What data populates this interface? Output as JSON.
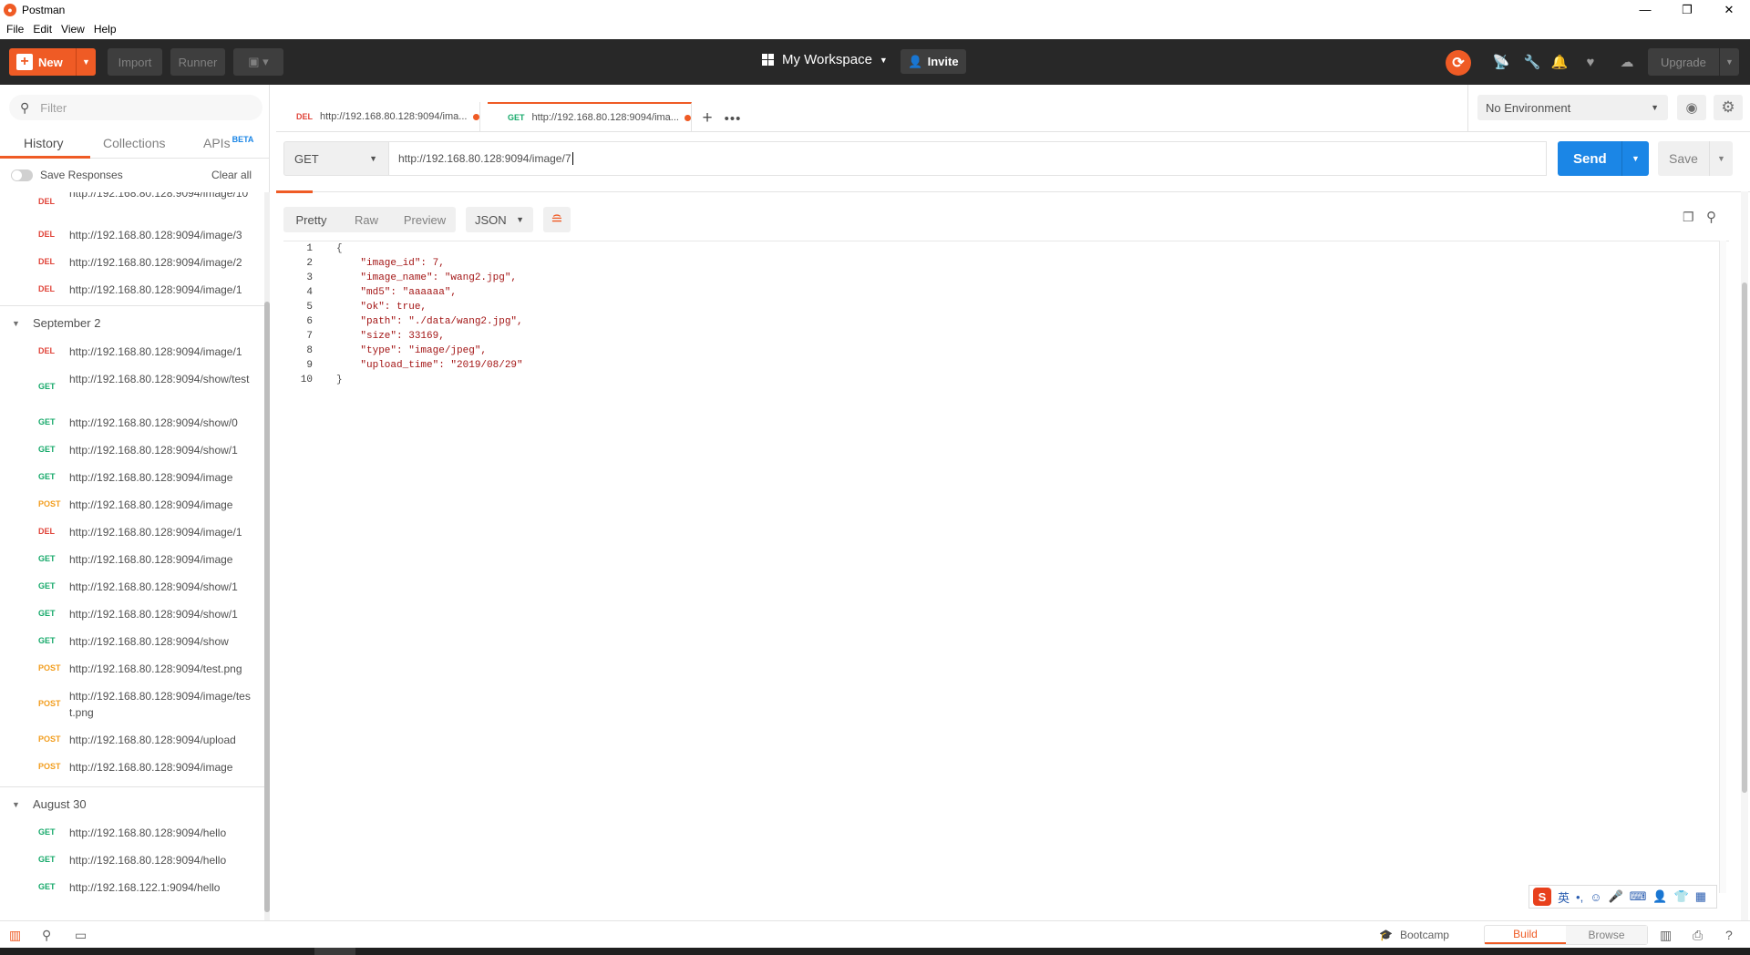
{
  "window": {
    "title": "Postman",
    "minimize_glyph": "—",
    "maximize_glyph": "❐",
    "close_glyph": "✕"
  },
  "menu": [
    "File",
    "Edit",
    "View",
    "Help"
  ],
  "header": {
    "new_label": "New",
    "import_label": "Import",
    "runner_label": "Runner",
    "workspace_label": "My Workspace",
    "invite_label": "Invite",
    "upgrade_label": "Upgrade"
  },
  "sidebar": {
    "filter_placeholder": "Filter",
    "tabs": [
      "History",
      "Collections",
      "APIs"
    ],
    "beta_badge": "BETA",
    "save_responses_label": "Save Responses",
    "clear_all_label": "Clear all",
    "groups": [
      {
        "label": "",
        "items": [
          {
            "method": "DEL",
            "url": "http://192.168.80.128:9094/image/10"
          },
          {
            "method": "DEL",
            "url": "http://192.168.80.128:9094/image/3"
          },
          {
            "method": "DEL",
            "url": "http://192.168.80.128:9094/image/2"
          },
          {
            "method": "DEL",
            "url": "http://192.168.80.128:9094/image/1"
          }
        ]
      },
      {
        "label": "September 2",
        "items": [
          {
            "method": "DEL",
            "url": "http://192.168.80.128:9094/image/1"
          },
          {
            "method": "GET",
            "url": "http://192.168.80.128:9094/show/test"
          },
          {
            "method": "GET",
            "url": "http://192.168.80.128:9094/show/0"
          },
          {
            "method": "GET",
            "url": "http://192.168.80.128:9094/show/1"
          },
          {
            "method": "GET",
            "url": "http://192.168.80.128:9094/image"
          },
          {
            "method": "POST",
            "url": "http://192.168.80.128:9094/image"
          },
          {
            "method": "DEL",
            "url": "http://192.168.80.128:9094/image/1"
          },
          {
            "method": "GET",
            "url": "http://192.168.80.128:9094/image"
          },
          {
            "method": "GET",
            "url": "http://192.168.80.128:9094/show/1"
          },
          {
            "method": "GET",
            "url": "http://192.168.80.128:9094/show/1"
          },
          {
            "method": "GET",
            "url": "http://192.168.80.128:9094/show"
          },
          {
            "method": "POST",
            "url": "http://192.168.80.128:9094/test.png"
          },
          {
            "method": "POST",
            "url": "http://192.168.80.128:9094/image/test.png"
          },
          {
            "method": "POST",
            "url": "http://192.168.80.128:9094/upload"
          },
          {
            "method": "POST",
            "url": "http://192.168.80.128:9094/image"
          }
        ]
      },
      {
        "label": "August 30",
        "items": [
          {
            "method": "GET",
            "url": "http://192.168.80.128:9094/hello"
          },
          {
            "method": "GET",
            "url": "http://192.168.80.128:9094/hello"
          },
          {
            "method": "GET",
            "url": "http://192.168.122.1:9094/hello"
          }
        ]
      }
    ]
  },
  "request_tabs": [
    {
      "method": "DEL",
      "url": "http://192.168.80.128:9094/ima..."
    },
    {
      "method": "GET",
      "url": "http://192.168.80.128:9094/ima..."
    }
  ],
  "environment": {
    "selected": "No Environment"
  },
  "request": {
    "method": "GET",
    "url": "http://192.168.80.128:9094/image/7",
    "send_label": "Send",
    "save_label": "Save"
  },
  "response": {
    "views": [
      "Pretty",
      "Raw",
      "Preview"
    ],
    "format": "JSON",
    "lines": [
      "{",
      "    \"image_id\": 7,",
      "    \"image_name\": \"wang2.jpg\",",
      "    \"md5\": \"aaaaaa\",",
      "    \"ok\": true,",
      "    \"path\": \"./data/wang2.jpg\",",
      "    \"size\": 33169,",
      "    \"type\": \"image/jpeg\",",
      "    \"upload_time\": \"2019/08/29\"",
      "}"
    ]
  },
  "ime": {
    "logo": "S",
    "lang": "英"
  },
  "statusbar": {
    "bootcamp_label": "Bootcamp",
    "build_label": "Build",
    "browse_label": "Browse"
  },
  "colors": {
    "accent": "#ef5b25",
    "primary": "#1b86e6",
    "del": "#e0443a",
    "get": "#16a96a",
    "post": "#f29e1f",
    "header_bg": "#282828"
  }
}
